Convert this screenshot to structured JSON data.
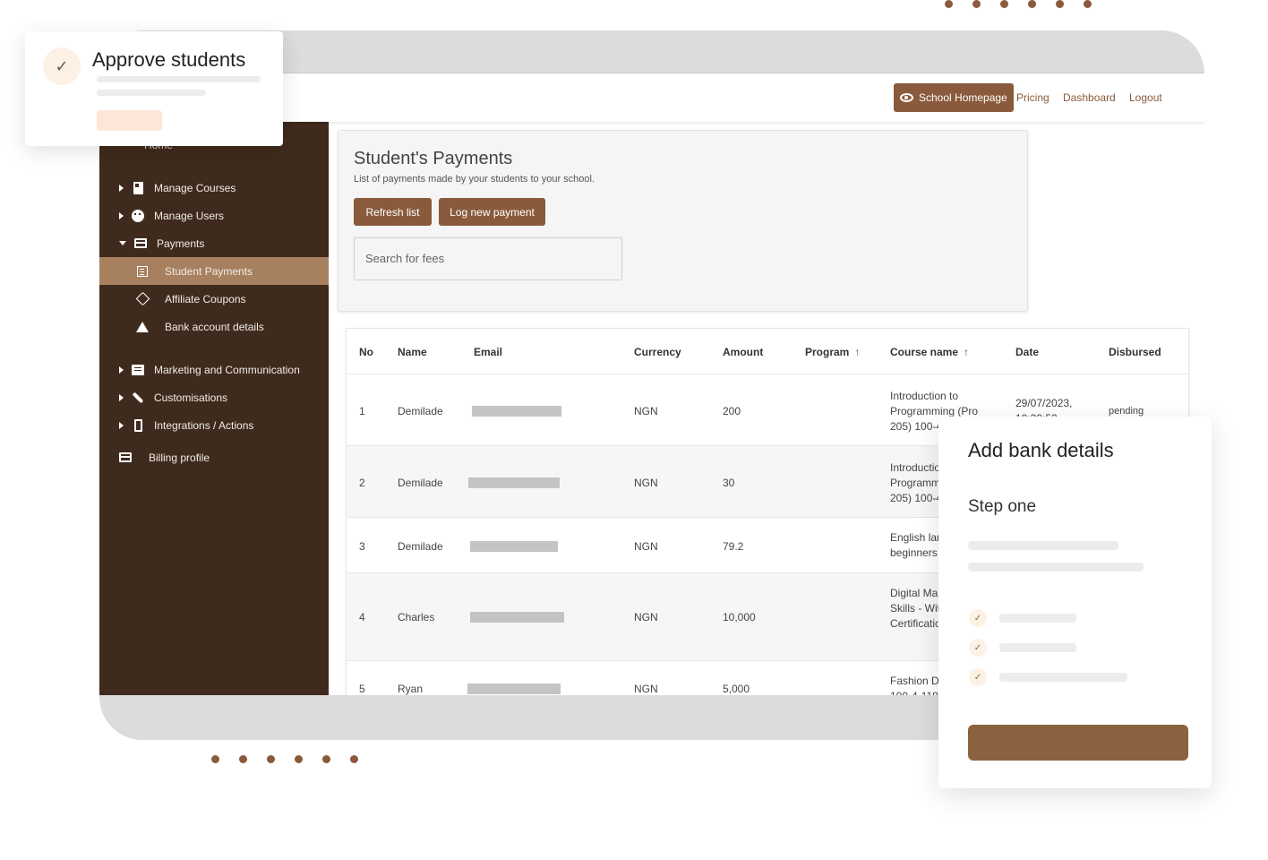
{
  "navbar": {
    "home_button": "School Homepage",
    "links": [
      "Pricing",
      "Dashboard",
      "Logout"
    ]
  },
  "sidebar": {
    "partial_item": "Home",
    "items": [
      {
        "label": "Manage Courses",
        "icon": "book-icon",
        "expandable": "collapsed"
      },
      {
        "label": "Manage Users",
        "icon": "users-icon",
        "expandable": "collapsed"
      },
      {
        "label": "Payments",
        "icon": "credit-card-icon",
        "expandable": "expanded"
      },
      {
        "label": "Student Payments",
        "icon": "list-icon",
        "active": true
      },
      {
        "label": "Affiliate Coupons",
        "icon": "tag-icon"
      },
      {
        "label": "Bank account details",
        "icon": "warning-icon"
      },
      {
        "label": "Marketing and Communication",
        "icon": "chat-icon",
        "expandable": "collapsed"
      },
      {
        "label": "Customisations",
        "icon": "wrench-icon",
        "expandable": "collapsed"
      },
      {
        "label": "Integrations / Actions",
        "icon": "phone-icon",
        "expandable": "collapsed"
      },
      {
        "label": "Billing profile",
        "icon": "credit-card-icon"
      }
    ]
  },
  "payments_panel": {
    "title": "Student's Payments",
    "subtitle": "List of payments made by your students to your school.",
    "refresh_label": "Refresh list",
    "log_label": "Log new payment",
    "search_placeholder": "Search for fees"
  },
  "table": {
    "headers": [
      "No",
      "Name",
      "Email",
      "Currency",
      "Amount",
      "Program",
      "Course name",
      "Date",
      "Disbursed"
    ],
    "rows": [
      {
        "no": "1",
        "name": "Demilade",
        "currency": "NGN",
        "amount": "200",
        "course": "Introduction to Programming (Pro 205) 100-4",
        "date": "29/07/2023,",
        "date2": "10:30:52",
        "disbursed": "pending"
      },
      {
        "no": "2",
        "name": "Demilade",
        "currency": "NGN",
        "amount": "30",
        "course": "Introduction to Programming (Pro 205) 100-4",
        "date": "",
        "date2": "",
        "disbursed": ""
      },
      {
        "no": "3",
        "name": "Demilade",
        "currency": "NGN",
        "amount": "79.2",
        "course": "English language for beginners",
        "date": "",
        "date2": "",
        "disbursed": ""
      },
      {
        "no": "4",
        "name": "Charles",
        "currency": "NGN",
        "amount": "10,000",
        "course": "Digital Marketing Skills - With Certification 111",
        "date": "",
        "date2": "",
        "disbursed": ""
      },
      {
        "no": "5",
        "name": "Ryan",
        "currency": "NGN",
        "amount": "5,000",
        "course": "Fashion Design 100-4-118",
        "date": "",
        "date2": "",
        "disbursed": ""
      }
    ]
  },
  "approve_card": {
    "title": "Approve students"
  },
  "bank_card": {
    "title": "Add bank details",
    "step": "Step one"
  },
  "colors": {
    "brand_brown": "#8a5a3c",
    "sidebar_bg": "#3f2b1d",
    "sidebar_active": "#a7805f"
  }
}
